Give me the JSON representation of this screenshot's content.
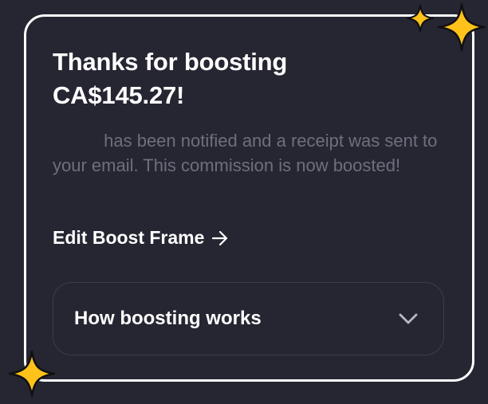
{
  "confirmation": {
    "title_line1": "Thanks for boosting",
    "title_line2": "CA$145.27!",
    "recipient_name": "",
    "message": "has been notified and a receipt was sent to your email. This commission is now boosted!",
    "edit_link_label": "Edit Boost Frame",
    "edit_link_icon": "arrow-right-icon",
    "accordion_label": "How boosting works",
    "accordion_icon": "chevron-down-icon"
  },
  "colors": {
    "background": "#262633",
    "card_border": "#ffffff",
    "title_text": "#ffffff",
    "muted_text": "#6f6f7c",
    "accordion_border": "#3c3c4a",
    "sparkle": "#ffc21a"
  },
  "decorations": [
    "sparkle-icon",
    "sparkle-icon",
    "sparkle-icon"
  ]
}
